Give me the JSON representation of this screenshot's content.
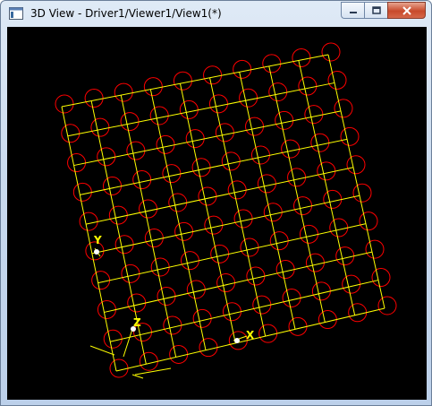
{
  "window": {
    "title": "3D View - Driver1/Viewer1/View1(*)",
    "controls": {
      "minimize_icon": "minimize-icon",
      "maximize_icon": "maximize-icon",
      "close_icon": "close-icon"
    }
  },
  "viewport": {
    "background": "#000000",
    "grid_color": "#ffff00",
    "circle_color": "#ff0000",
    "grid_lines_per_direction": 10,
    "circles_per_side": 10,
    "axes": {
      "x_label": "X",
      "y_label": "Y",
      "z_label": "Z",
      "color": "#ffff00",
      "marker_color": "#ffffff"
    }
  }
}
